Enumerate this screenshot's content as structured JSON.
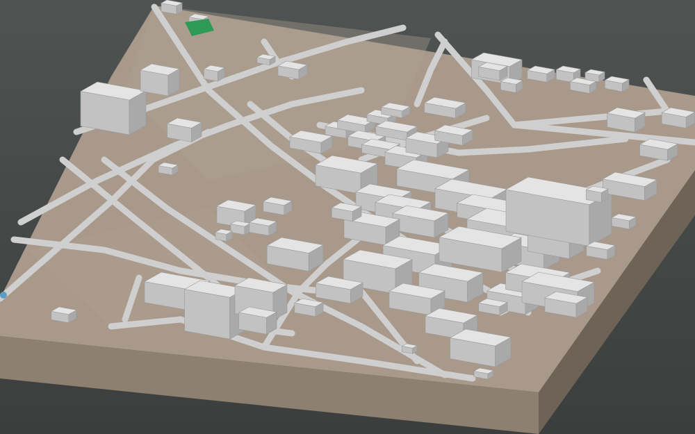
{
  "scene": {
    "kind": "3d-city-terrain-model",
    "colors": {
      "background_top": "#4f5352",
      "background_bottom": "#3b3e3d",
      "terrain": "#a8998a",
      "terrain_light": "#b3a594",
      "terrain_side_front": "#8e8070",
      "terrain_side_right": "#6e6357",
      "road": "#cfcfcf",
      "building_top": "#e4e4e4",
      "building_side_a": "#c2c2c2",
      "building_side_b": "#a9a9a9",
      "park": "#2f9a56",
      "water": "#5a9cc4"
    }
  }
}
